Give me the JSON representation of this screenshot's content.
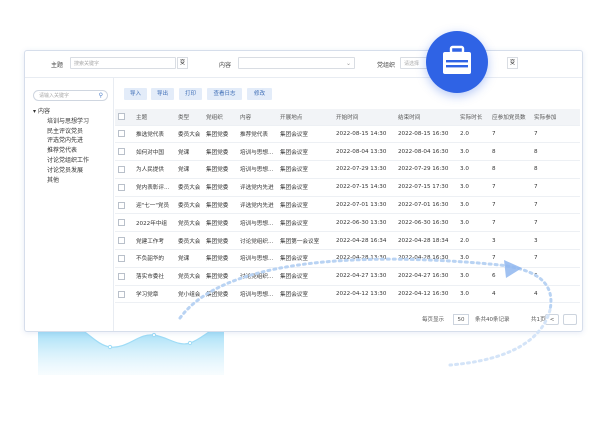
{
  "filters": {
    "subject_label": "主题",
    "subject_placeholder": "搜索关键字",
    "subject_button": "变",
    "content_label": "内容",
    "org_label": "党组织",
    "org_placeholder": "请选择",
    "org_button": "变"
  },
  "sidebar": {
    "search_placeholder": "请输入关键字",
    "root": "内容",
    "items": [
      "培训与思想学习",
      "民主评议党员",
      "评选党内先进",
      "推荐党代表",
      "讨论党组织工作",
      "讨论党员发展",
      "其他"
    ]
  },
  "toolbar": {
    "import": "导入",
    "export": "导出",
    "print": "打印",
    "view_log": "查看日志",
    "edit": "修改"
  },
  "table": {
    "columns": [
      "主题",
      "类型",
      "党组织",
      "内容",
      "开展地点",
      "开始时间",
      "结束时间",
      "实际时长",
      "应参加党员数",
      "实际参加"
    ],
    "rows": [
      [
        "推选党代表",
        "委员大会",
        "集团党委",
        "推荐党代表",
        "集团会议室",
        "2022-08-15 14:30",
        "2022-08-15 16:30",
        "2.0",
        "7",
        "7"
      ],
      [
        "如何对中国",
        "党课",
        "集团党委",
        "培训与思想...",
        "集团会议室",
        "2022-08-04 13:30",
        "2022-08-04 16:30",
        "3.0",
        "8",
        "8"
      ],
      [
        "为人民提供",
        "党课",
        "集团党委",
        "培训与思想...",
        "集团会议室",
        "2022-07-29 13:30",
        "2022-07-29 16:30",
        "3.0",
        "8",
        "8"
      ],
      [
        "党内表彰评...",
        "委员大会",
        "集团党委",
        "评选党内先进",
        "集团会议室",
        "2022-07-15 14:30",
        "2022-07-15 17:30",
        "3.0",
        "7",
        "7"
      ],
      [
        "迎\"七一\"党员",
        "委员大会",
        "集团党委",
        "评选党内先进",
        "集团会议室",
        "2022-07-01 13:30",
        "2022-07-01 16:30",
        "3.0",
        "7",
        "7"
      ],
      [
        "2022年中组",
        "党员大会",
        "集团党委",
        "培训与思想...",
        "集团会议室",
        "2022-06-30 13:30",
        "2022-06-30 16:30",
        "3.0",
        "7",
        "7"
      ],
      [
        "党建工作考",
        "委员大会",
        "集团党委",
        "讨论党组织...",
        "集团第一会议室",
        "2022-04-28 16:34",
        "2022-04-28 18:34",
        "2.0",
        "3",
        "3"
      ],
      [
        "不负韶华的",
        "党课",
        "集团党委",
        "培训与思想...",
        "集团会议室",
        "2022-04-28 13:30",
        "2022-04-28 16:30",
        "3.0",
        "7",
        "7"
      ],
      [
        "落实市委社",
        "党员大会",
        "集团党委",
        "讨论党组织...",
        "集团会议室",
        "2022-04-27 13:30",
        "2022-04-27 16:30",
        "3.0",
        "6",
        "6"
      ],
      [
        "学习党章",
        "党小组会",
        "集团党委",
        "培训与思想...",
        "集团会议室",
        "2022-04-12 13:30",
        "2022-04-12 16:30",
        "3.0",
        "4",
        "4"
      ]
    ]
  },
  "pager": {
    "per_page_label": "每页显示",
    "per_page": "50",
    "total": "条共40条记录",
    "page": "共1页",
    "prev": "<"
  },
  "icons": {
    "badge": "suitcase-icon",
    "search": "search-icon"
  },
  "colors": {
    "accent": "#2f63e5",
    "toolbar_button_bg": "#e3ecf9",
    "toolbar_button_text": "#3a6bb5",
    "wave": "#7fd0f2"
  }
}
